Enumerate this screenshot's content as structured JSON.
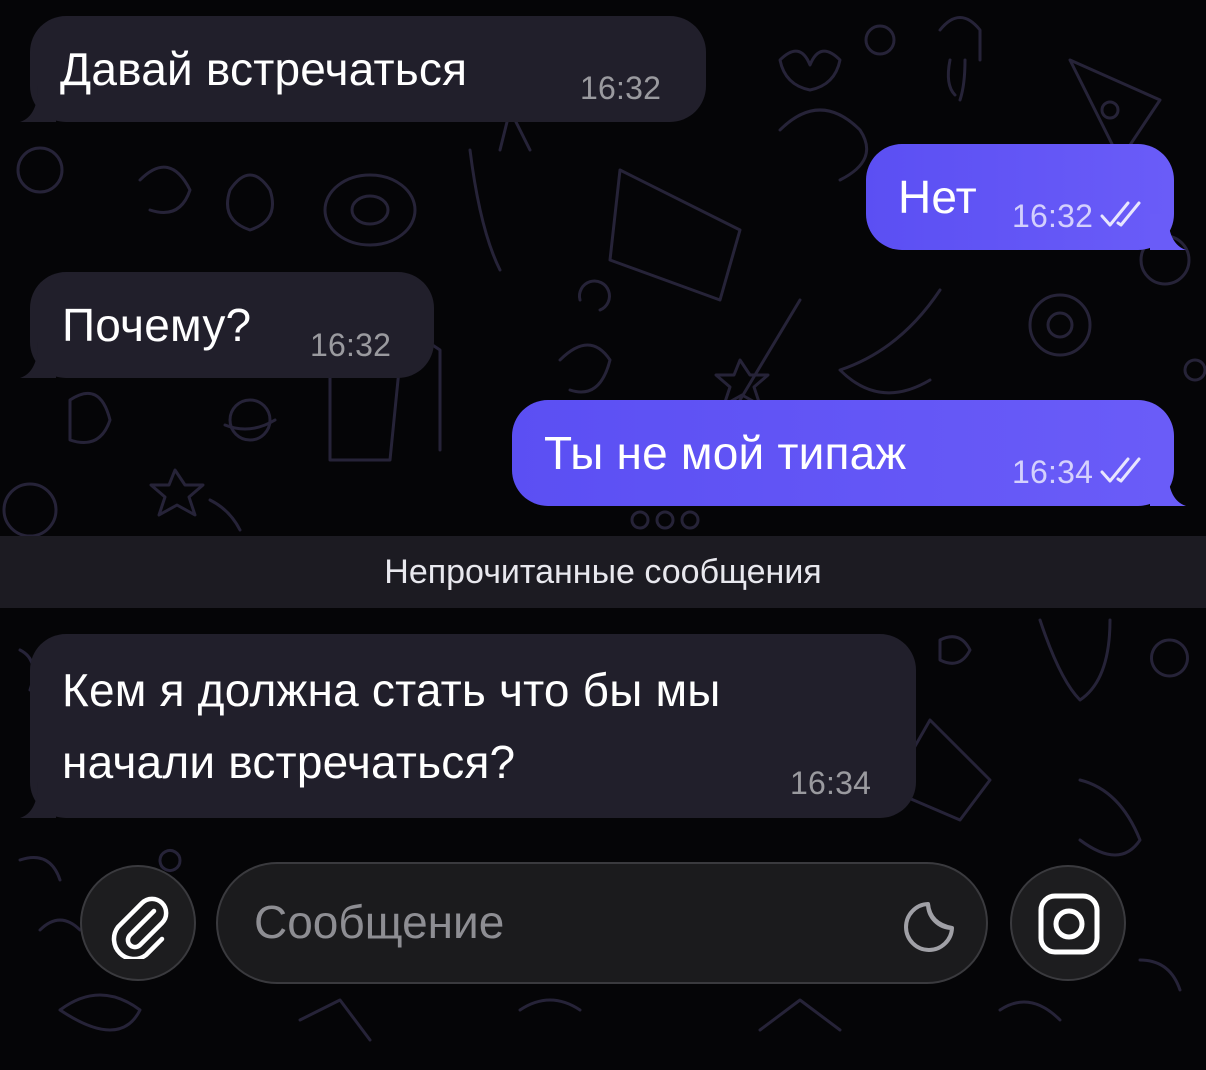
{
  "chat": {
    "messages": [
      {
        "direction": "incoming",
        "text": "Давай встречаться",
        "time": "16:32"
      },
      {
        "direction": "outgoing",
        "text": "Нет",
        "time": "16:32",
        "status": "read"
      },
      {
        "direction": "incoming",
        "text": "Почему?",
        "time": "16:32"
      },
      {
        "direction": "outgoing",
        "text": "Ты не мой типаж",
        "time": "16:34",
        "status": "read"
      },
      {
        "direction": "incoming",
        "lines": [
          "Кем я должна стать что бы мы",
          "начали встречаться?"
        ],
        "time": "16:34"
      }
    ],
    "unread_divider": "Непрочитанные сообщения"
  },
  "composer": {
    "placeholder": "Сообщение",
    "attach_icon": "paperclip-icon",
    "sticker_icon": "sticker-icon",
    "camera_icon": "camera-icon"
  },
  "colors": {
    "background": "#050507",
    "incoming_bubble": "#211f2b",
    "outgoing_bubble": "#5f52f5",
    "divider": "#1c1b22",
    "doodle_stroke": "#2a2640"
  }
}
